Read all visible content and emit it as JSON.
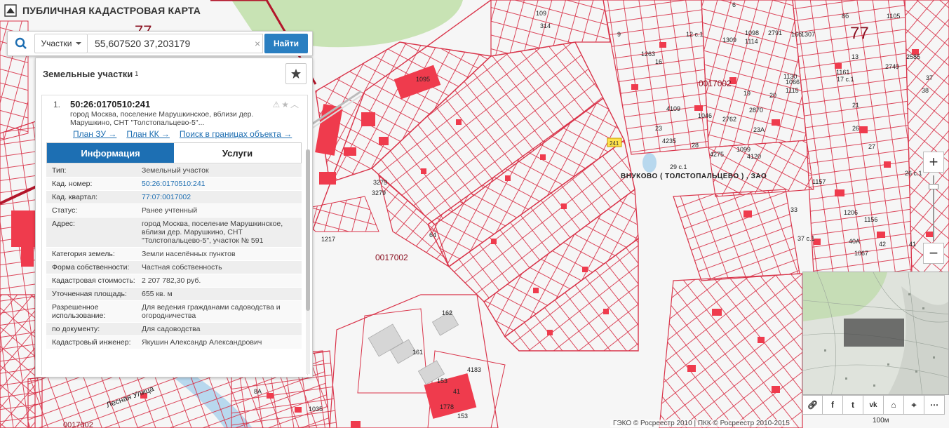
{
  "app": {
    "title": "ПУБЛИЧНАЯ КАДАСТРОВАЯ КАРТА"
  },
  "search": {
    "type_label": "Участки",
    "query": "55,607520 37,203179",
    "submit_label": "Найти",
    "clear": "×"
  },
  "panel": {
    "title": "Земельные участки",
    "count": "1",
    "result": {
      "index": "1.",
      "number": "50:26:0170510:241",
      "address": "город Москва, поселение Марушкинское, вблизи дер. Марушкино, СНТ \"Толстопальцево-5\"...",
      "links": [
        "План ЗУ →",
        "План КК →",
        "Поиск в границах объекта →"
      ],
      "tabs": [
        "Информация",
        "Услуги"
      ],
      "rows": [
        {
          "key": "Тип:",
          "value": "Земельный участок"
        },
        {
          "key": "Кад. номер:",
          "value": "50:26:0170510:241"
        },
        {
          "key": "Кад. квартал:",
          "value": "77:07:0017002"
        },
        {
          "key": "Статус:",
          "value": "Ранее учтенный"
        },
        {
          "key": "Адрес:",
          "value": "город Москва, поселение Марушкинское, вблизи дер. Марушкино, СНТ \"Толстопальцево-5\", участок № 591"
        },
        {
          "key": "Категория земель:",
          "value": "Земли населённых пунктов"
        },
        {
          "key": "Форма собственности:",
          "value": "Частная собственность"
        },
        {
          "key": "Кадастровая стоимость:",
          "value": "2 207 782,30 руб."
        },
        {
          "key": "Уточненная площадь:",
          "value": "655 кв. м"
        },
        {
          "key": "Разрешенное использование:",
          "value": "Для ведения гражданами садоводства и огородничества"
        },
        {
          "key": "по документу:",
          "value": "Для садоводства"
        },
        {
          "key": "Кадастровый инженер:",
          "value": "Якушин Александр Александрович"
        }
      ]
    }
  },
  "map": {
    "region_codes": [
      "77",
      "77"
    ],
    "quarter_labels": [
      "0017002",
      "0017002",
      "0017002"
    ],
    "district_label": "ВНУКОВО ( ТОЛСТОПАЛЬЦЕВО ) , ЗАО",
    "street_label": "Лесная Улица",
    "highlighted_parcel": "241",
    "parcel_labels": [
      "1095",
      "162",
      "161",
      "153",
      "41",
      "4183",
      "1778",
      "153",
      "3279",
      "3279",
      "1217",
      "109",
      "314",
      "64",
      "13",
      "16",
      "19",
      "20",
      "21",
      "23",
      "23А",
      "26",
      "27",
      "28",
      "29 с.1",
      "33",
      "37 с.1",
      "40А",
      "41",
      "42",
      "1161",
      "1115",
      "17 с.1",
      "12 с.1",
      "16б",
      "8б",
      "9",
      "37",
      "38",
      "6",
      "8А",
      "26 с.1",
      "1035",
      "1067",
      "1206",
      "1156",
      "1157",
      "4109",
      "4235",
      "1046",
      "2762",
      "4275",
      "1099",
      "4120",
      "2870",
      "2791",
      "1098",
      "1307",
      "1130",
      "1066",
      "1105",
      "2585",
      "2749",
      "1114",
      "1309",
      "1263"
    ],
    "colors": {
      "parcel_stroke": "#d9344a",
      "building_fill": "#ef3b4d",
      "highlight": "#ffe24a",
      "forest": "#c8e3b4",
      "circle": "#7a1020"
    },
    "copyright": "ГЭКО © Росреестр 2010 | ПКК © Росреестр 2010-2015",
    "scale": "100м"
  },
  "controls": {
    "zoom_in": "+",
    "zoom_out": "−",
    "share": [
      "link",
      "f",
      "twitter",
      "vk",
      "home",
      "locate",
      "more"
    ]
  }
}
